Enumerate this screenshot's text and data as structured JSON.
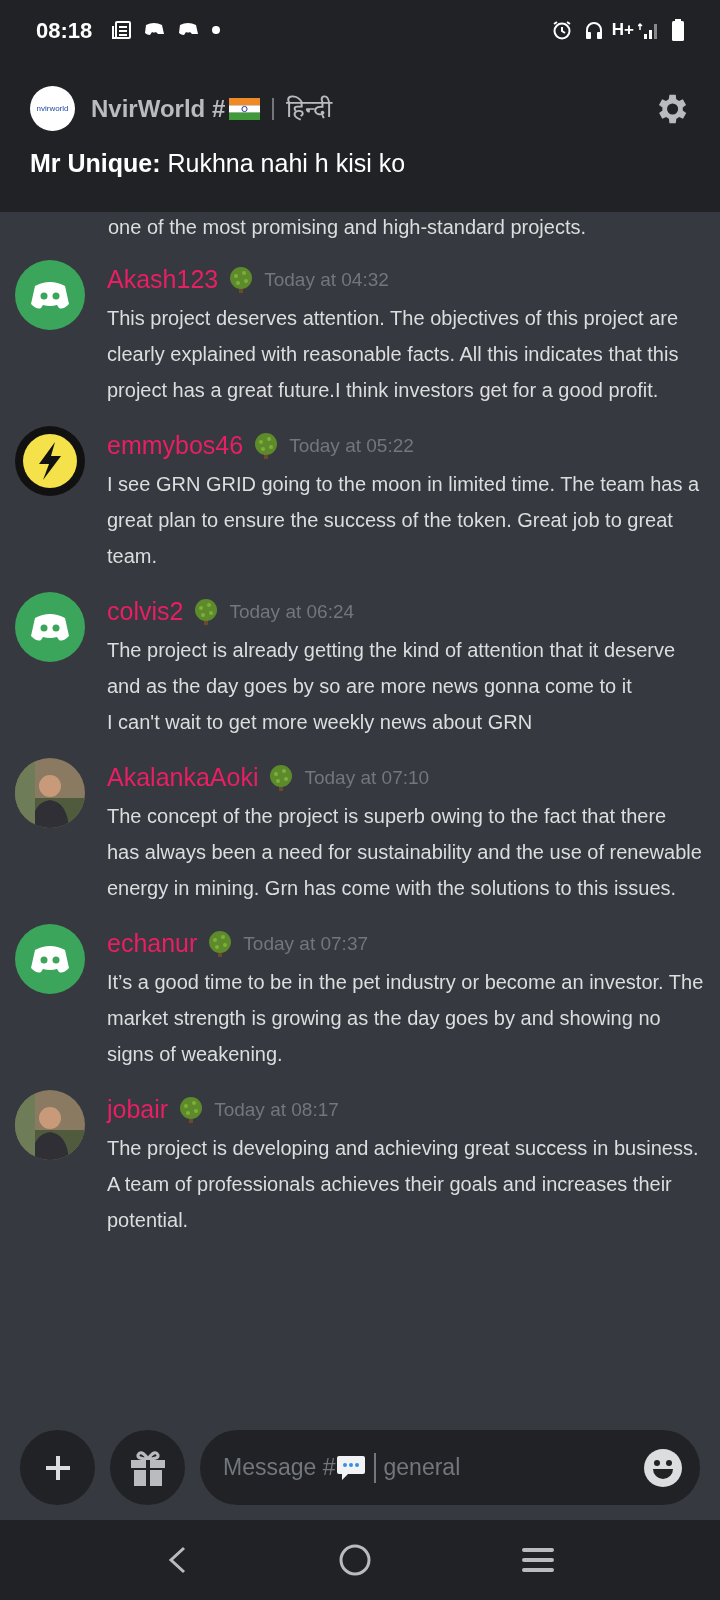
{
  "status_bar": {
    "time": "08:18",
    "network": "H+"
  },
  "header": {
    "server_logo": "nvirworld",
    "server_name": "NvirWorld #",
    "language": "हिन्दी",
    "pinned_message": "**Mr Unique:** Rukhna nahi h kisi ko"
  },
  "previous_message_tail": "one of the most promising and high-standard projects.",
  "messages": [
    {
      "kind": "discord",
      "author": "Akash123",
      "time": "Today at 04:32",
      "text": "This project deserves attention. The objectives of this project are clearly explained with reasonable facts. All this indicates that this project has a great future.I think investors get for a good profit."
    },
    {
      "kind": "bolt",
      "author": "emmybos46",
      "time": "Today at 05:22",
      "text": "I see GRN GRID going to the moon in limited time. The team has a great plan to ensure the success of the token. Great job to great team."
    },
    {
      "kind": "discord",
      "author": "colvis2",
      "time": "Today at 06:24",
      "text": "The project is already getting the kind of attention that it deserve and as the day goes by so are more news gonna come to it\nI can't wait to get more weekly news about GRN"
    },
    {
      "author": "AkalankaAoki",
      "time": "Today at 07:10",
      "text": "The concept of the project is superb owing to the fact that there has always been a need for sustainability and the use of renewable energy in mining. Grn has come with the solutions to this issues."
    },
    {
      "kind": "discord",
      "author": "echanur",
      "time": "Today at 07:37",
      "text": "It’s a good time to be in the pet industry or become an investor. The market strength is growing as the day goes by and showing no signs of weakening."
    },
    {
      "author": "jobair",
      "time": "Today at 08:17",
      "text": "The project is developing and achieving great success in business. A team of professionals achieves their goals and increases their potential."
    }
  ],
  "composer": {
    "placeholder": "Message #",
    "channel": "general"
  }
}
